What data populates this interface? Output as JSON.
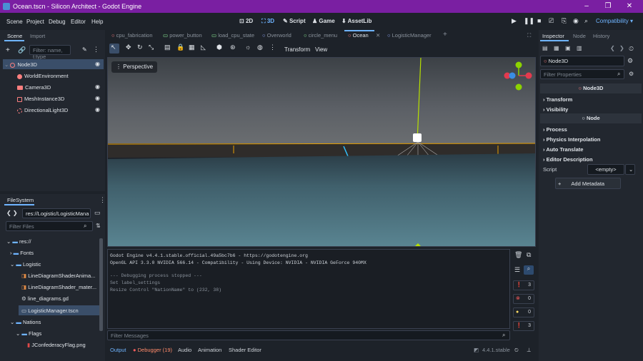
{
  "window": {
    "title": "Ocean.tscn - Silicon Architect - Godot Engine"
  },
  "menu": [
    "Scene",
    "Project",
    "Debug",
    "Editor",
    "Help"
  ],
  "workspaces": [
    {
      "label": "2D"
    },
    {
      "label": "3D"
    },
    {
      "label": "Script"
    },
    {
      "label": "Game"
    },
    {
      "label": "AssetLib"
    }
  ],
  "renderer": "Compatibility",
  "scene_dock": {
    "tabs": [
      "Scene",
      "Import"
    ],
    "filter_placeholder": "Filter: name, t:type",
    "nodes": [
      {
        "name": "Node3D"
      },
      {
        "name": "WorldEnvironment"
      },
      {
        "name": "Camera3D"
      },
      {
        "name": "MeshInstance3D"
      },
      {
        "name": "DirectionalLight3D"
      }
    ]
  },
  "filesystem": {
    "title": "FileSystem",
    "path": "res://Logistic/LogisticMana",
    "filter_placeholder": "Filter Files",
    "items": [
      {
        "name": "res://"
      },
      {
        "name": "Fonts"
      },
      {
        "name": "Logistic"
      },
      {
        "name": "LineDiagramShaderAnima..."
      },
      {
        "name": "LineDiagramShader_mater..."
      },
      {
        "name": "line_diagrams.gd"
      },
      {
        "name": "LogisticManager.tscn"
      },
      {
        "name": "Nations"
      },
      {
        "name": "Flags"
      },
      {
        "name": "JConfederacyFlag.png"
      }
    ]
  },
  "scene_tabs": [
    "cpu_fabrication",
    "power_button",
    "load_cpu_state",
    "Overworld",
    "circle_menu",
    "Ocean",
    "LogisticManager"
  ],
  "toolbar": {
    "transform": "Transform",
    "view": "View"
  },
  "viewport": {
    "label": "Perspective"
  },
  "output": {
    "lines": [
      "Godot Engine v4.4.1.stable.official.49a5bc7b6 - https://godotengine.org",
      "OpenGL API 3.3.0 NVIDIA 566.14 - Compatibility - Using Device: NVIDIA - NVIDIA GeForce 940MX",
      "",
      "--- Debugging process stopped ---",
      "Set label_settings",
      "Resize Control \"NationName\" to (232, 38)"
    ],
    "filter_placeholder": "Filter Messages",
    "counts": {
      "messages": "3",
      "errors": "0",
      "warnings": "0",
      "info": "3"
    }
  },
  "bottom_tabs": [
    "Output",
    "Debugger (19)",
    "Audio",
    "Animation",
    "Shader Editor"
  ],
  "version": "4.4.1.stable",
  "inspector": {
    "tabs": [
      "Inspector",
      "Node",
      "History"
    ],
    "object": "Node3D",
    "filter_placeholder": "Filter Properties",
    "class_header": "Node3D",
    "sections_top": [
      "Transform",
      "Visibility"
    ],
    "node_header": "Node",
    "sections_node": [
      "Process",
      "Physics Interpolation",
      "Auto Translate",
      "Editor Description"
    ],
    "script_label": "Script",
    "script_value": "<empty>",
    "add_metadata": "Add Metadata"
  },
  "colors": {
    "accent": "#6fb4ff",
    "title_bar": "#7a1fa2",
    "node3d": "#fc7f7f"
  }
}
